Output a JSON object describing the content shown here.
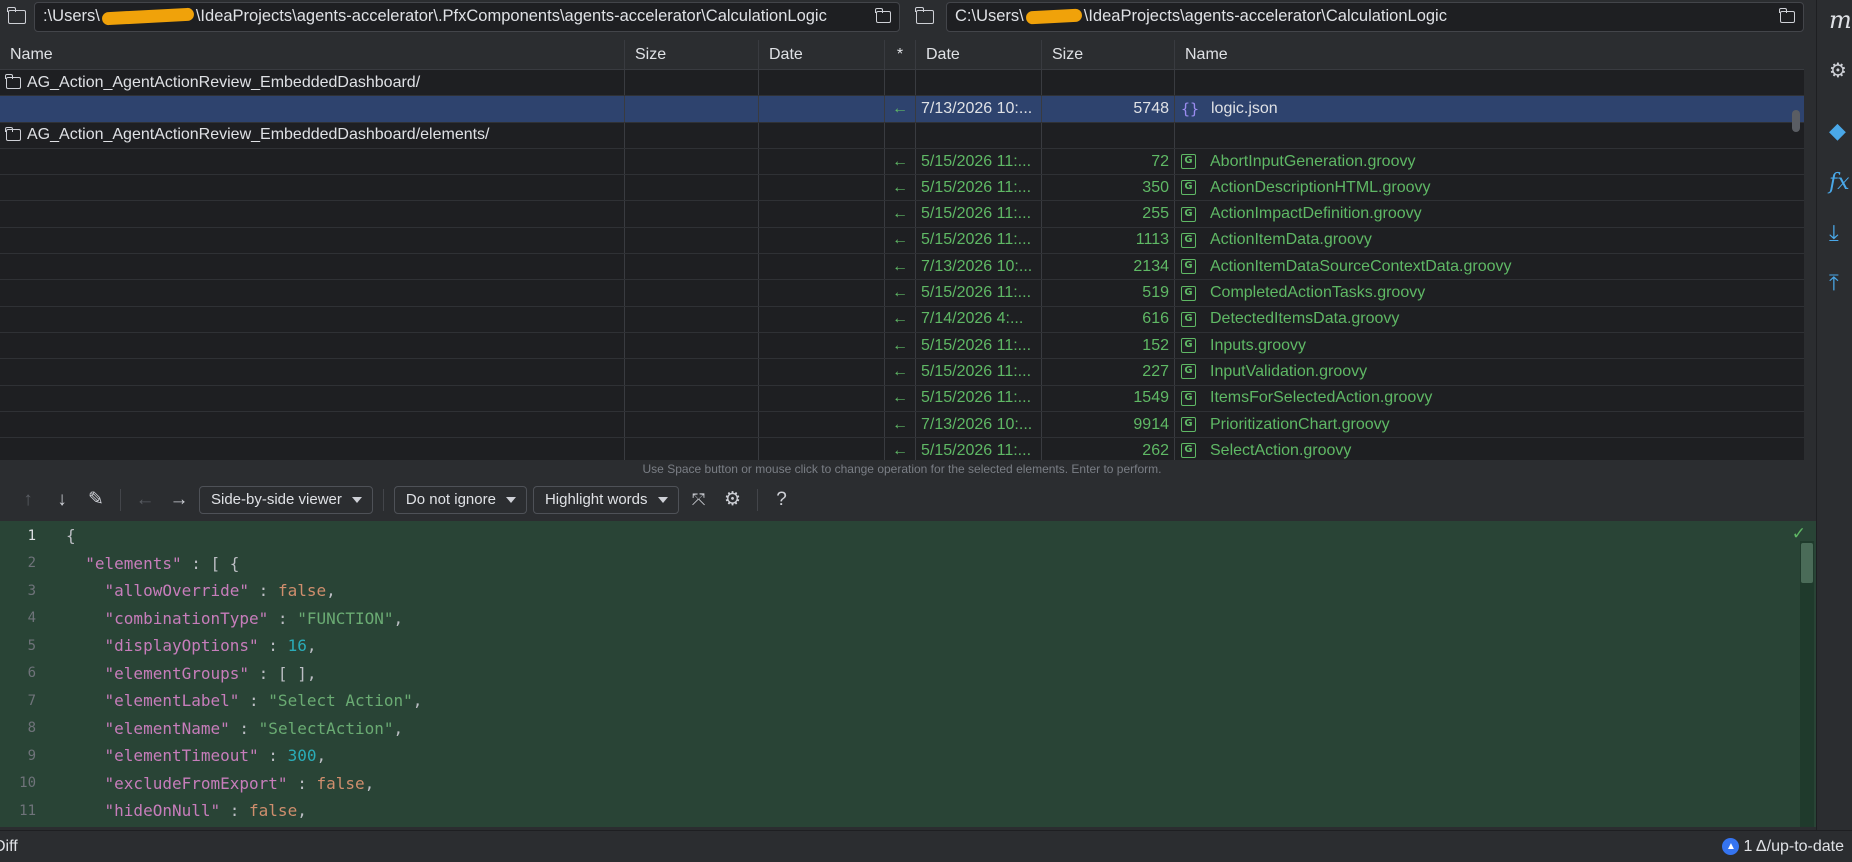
{
  "left_path": {
    "prefix": ":\\Users\\",
    "suffix": "\\IdeaProjects\\agents-accelerator\\.PfxComponents\\agents-accelerator\\CalculationLogic"
  },
  "right_path": {
    "prefix": "C:\\Users\\",
    "suffix": "\\IdeaProjects\\agents-accelerator\\CalculationLogic"
  },
  "columns": {
    "left_name": "Name",
    "left_size": "Size",
    "left_date": "Date",
    "op": "*",
    "right_date": "Date",
    "right_size": "Size",
    "right_name": "Name"
  },
  "rows": [
    {
      "type": "dir",
      "left_name": "AG_Action_AgentActionReview_EmbeddedDashboard/"
    },
    {
      "type": "file",
      "selected": true,
      "op": "←",
      "date": "7/13/2026 10:...",
      "size": "5748",
      "icon": "json-icon",
      "name": "logic.json"
    },
    {
      "type": "dir",
      "left_name": "AG_Action_AgentActionReview_EmbeddedDashboard/elements/"
    },
    {
      "type": "file",
      "op": "←",
      "date": "5/15/2026 11:...",
      "size": "72",
      "icon": "groovy-icon",
      "name": "AbortInputGeneration.groovy"
    },
    {
      "type": "file",
      "op": "←",
      "date": "5/15/2026 11:...",
      "size": "350",
      "icon": "groovy-icon",
      "name": "ActionDescriptionHTML.groovy"
    },
    {
      "type": "file",
      "op": "←",
      "date": "5/15/2026 11:...",
      "size": "255",
      "icon": "groovy-icon",
      "name": "ActionImpactDefinition.groovy"
    },
    {
      "type": "file",
      "op": "←",
      "date": "5/15/2026 11:...",
      "size": "1113",
      "icon": "groovy-icon",
      "name": "ActionItemData.groovy"
    },
    {
      "type": "file",
      "op": "←",
      "date": "7/13/2026 10:...",
      "size": "2134",
      "icon": "groovy-icon",
      "name": "ActionItemDataSourceContextData.groovy"
    },
    {
      "type": "file",
      "op": "←",
      "date": "5/15/2026 11:...",
      "size": "519",
      "icon": "groovy-icon",
      "name": "CompletedActionTasks.groovy"
    },
    {
      "type": "file",
      "op": "←",
      "date": "7/14/2026 4:...",
      "size": "616",
      "icon": "groovy-icon",
      "name": "DetectedItemsData.groovy"
    },
    {
      "type": "file",
      "op": "←",
      "date": "5/15/2026 11:...",
      "size": "152",
      "icon": "groovy-icon",
      "name": "Inputs.groovy"
    },
    {
      "type": "file",
      "op": "←",
      "date": "5/15/2026 11:...",
      "size": "227",
      "icon": "groovy-icon",
      "name": "InputValidation.groovy"
    },
    {
      "type": "file",
      "op": "←",
      "date": "5/15/2026 11:...",
      "size": "1549",
      "icon": "groovy-icon",
      "name": "ItemsForSelectedAction.groovy"
    },
    {
      "type": "file",
      "op": "←",
      "date": "7/13/2026 10:...",
      "size": "9914",
      "icon": "groovy-icon",
      "name": "PrioritizationChart.groovy"
    },
    {
      "type": "file",
      "op": "←",
      "date": "5/15/2026 11:...",
      "size": "262",
      "icon": "groovy-icon",
      "name": "SelectAction.groovy"
    }
  ],
  "hint": "Use Space button or mouse click to change operation for the selected elements. Enter to perform.",
  "toolbar": {
    "viewer": "Side-by-side viewer",
    "ignore": "Do not ignore",
    "highlight": "Highlight words",
    "help": "?"
  },
  "code_lines": [
    {
      "n": "1",
      "parts": [
        [
          "p",
          "{"
        ]
      ]
    },
    {
      "n": "2",
      "parts": [
        [
          "p",
          "  "
        ],
        [
          "k",
          "\"elements\""
        ],
        [
          "p",
          " : [ {"
        ]
      ]
    },
    {
      "n": "3",
      "parts": [
        [
          "p",
          "    "
        ],
        [
          "k",
          "\"allowOverride\""
        ],
        [
          "p",
          " : "
        ],
        [
          "b",
          "false"
        ],
        [
          "p",
          ","
        ]
      ]
    },
    {
      "n": "4",
      "parts": [
        [
          "p",
          "    "
        ],
        [
          "k",
          "\"combinationType\""
        ],
        [
          "p",
          " : "
        ],
        [
          "s",
          "\"FUNCTION\""
        ],
        [
          "p",
          ","
        ]
      ]
    },
    {
      "n": "5",
      "parts": [
        [
          "p",
          "    "
        ],
        [
          "k",
          "\"displayOptions\""
        ],
        [
          "p",
          " : "
        ],
        [
          "n",
          "16"
        ],
        [
          "p",
          ","
        ]
      ]
    },
    {
      "n": "6",
      "parts": [
        [
          "p",
          "    "
        ],
        [
          "k",
          "\"elementGroups\""
        ],
        [
          "p",
          " : [ ],"
        ]
      ]
    },
    {
      "n": "7",
      "parts": [
        [
          "p",
          "    "
        ],
        [
          "k",
          "\"elementLabel\""
        ],
        [
          "p",
          " : "
        ],
        [
          "s",
          "\"Select Action\""
        ],
        [
          "p",
          ","
        ]
      ]
    },
    {
      "n": "8",
      "parts": [
        [
          "p",
          "    "
        ],
        [
          "k",
          "\"elementName\""
        ],
        [
          "p",
          " : "
        ],
        [
          "s",
          "\"SelectAction\""
        ],
        [
          "p",
          ","
        ]
      ]
    },
    {
      "n": "9",
      "parts": [
        [
          "p",
          "    "
        ],
        [
          "k",
          "\"elementTimeout\""
        ],
        [
          "p",
          " : "
        ],
        [
          "n",
          "300"
        ],
        [
          "p",
          ","
        ]
      ]
    },
    {
      "n": "10",
      "parts": [
        [
          "p",
          "    "
        ],
        [
          "k",
          "\"excludeFromExport\""
        ],
        [
          "p",
          " : "
        ],
        [
          "b",
          "false"
        ],
        [
          "p",
          ","
        ]
      ]
    },
    {
      "n": "11",
      "parts": [
        [
          "p",
          "    "
        ],
        [
          "k",
          "\"hideOnNull\""
        ],
        [
          "p",
          " : "
        ],
        [
          "b",
          "false"
        ],
        [
          "p",
          ","
        ]
      ]
    }
  ],
  "status": {
    "left": "Diff",
    "right": "1 Δ/up-to-date"
  },
  "colors": {
    "added_bg": "#294436",
    "selection": "#2e436e",
    "status_green": "#5fb865"
  }
}
